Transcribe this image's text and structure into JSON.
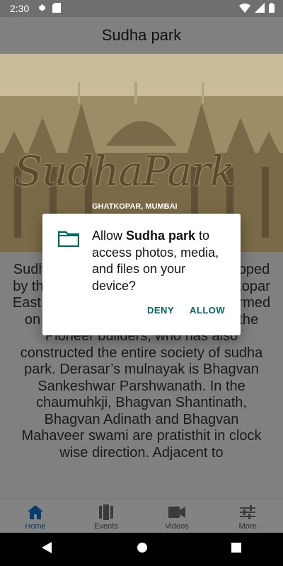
{
  "status_bar": {
    "time": "2:30",
    "icons": [
      "gear-icon",
      "sd-card-icon",
      "wifi-icon",
      "signal-icon",
      "battery-icon"
    ]
  },
  "app_bar": {
    "title": "Sudha park"
  },
  "hero": {
    "title": "SudhaPark",
    "subtitle": "GHATKOPAR, MUMBAI"
  },
  "content": {
    "description": "Sudha Park Jain Derasar was developed by the pioneer of Sudha Park, Ghatkopar East. The Pratishtha here was performed on year 2006 by Champalal Seth, the Pioneer builders, who has also constructed the entire society of sudha park. Derasar’s mulnayak is Bhagvan Sankeshwar Parshwanath. In the chaumuhkji, Bhagvan Shantinath, Bhagvan Adinath and Bhagvan Mahaveer swami are pratisthit in clock wise direction. Adjacent to"
  },
  "bottom_nav": {
    "items": [
      {
        "label": "Home",
        "icon": "home-icon",
        "active": true
      },
      {
        "label": "Events",
        "icon": "events-icon",
        "active": false
      },
      {
        "label": "Videos",
        "icon": "videocam-icon",
        "active": false
      },
      {
        "label": "More",
        "icon": "tune-icon",
        "active": false
      }
    ]
  },
  "dialog": {
    "message_prefix": "Allow ",
    "app_name": "Sudha park",
    "message_suffix": " to access photos, media, and files on your device?",
    "deny_label": "DENY",
    "allow_label": "ALLOW",
    "icon": "folder-icon",
    "accent_color": "#00695c"
  },
  "colors": {
    "active_nav": "#0a3b6a",
    "scrim_bg": "#808080"
  }
}
